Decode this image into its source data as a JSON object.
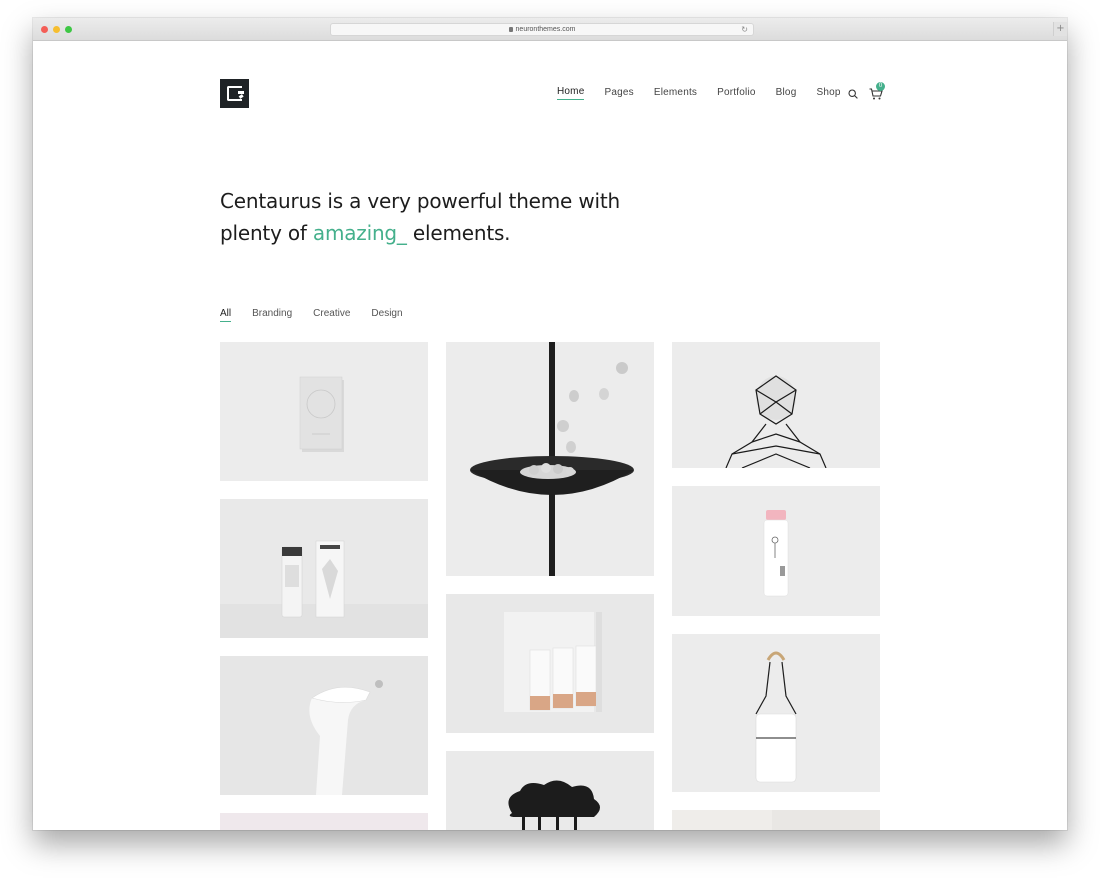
{
  "browser": {
    "url": "neuronthemes.com",
    "new_tab_label": "+"
  },
  "logo": {
    "name": "centaurus-logo"
  },
  "nav": {
    "items": [
      {
        "label": "Home",
        "active": true
      },
      {
        "label": "Pages",
        "active": false
      },
      {
        "label": "Elements",
        "active": false
      },
      {
        "label": "Portfolio",
        "active": false
      },
      {
        "label": "Blog",
        "active": false
      },
      {
        "label": "Shop",
        "active": false
      }
    ],
    "cart_count": "0"
  },
  "hero": {
    "line1": "Centaurus is a very powerful theme with",
    "line2_prefix": "plenty of ",
    "line2_accent": "amazing_",
    "line2_suffix": " elements."
  },
  "filters": [
    {
      "label": "All",
      "active": true
    },
    {
      "label": "Branding",
      "active": false
    },
    {
      "label": "Creative",
      "active": false
    },
    {
      "label": "Design",
      "active": false
    }
  ],
  "colors": {
    "accent": "#45b08c",
    "logo_bg": "#1f2326",
    "text": "#1d1d1d"
  },
  "portfolio": {
    "items": [
      {
        "name": "white-box-mockup"
      },
      {
        "name": "bowl-with-stones"
      },
      {
        "name": "wire-bust-sculpture"
      },
      {
        "name": "cosmetic-bottle-packaging"
      },
      {
        "name": "milk-bottle-mockup"
      },
      {
        "name": "white-vessel-object"
      },
      {
        "name": "business-cards-mockup"
      },
      {
        "name": "glass-bottle-with-handle"
      },
      {
        "name": "pink-card-partial"
      },
      {
        "name": "black-cloud-object"
      },
      {
        "name": "grey-room-partial"
      }
    ]
  }
}
